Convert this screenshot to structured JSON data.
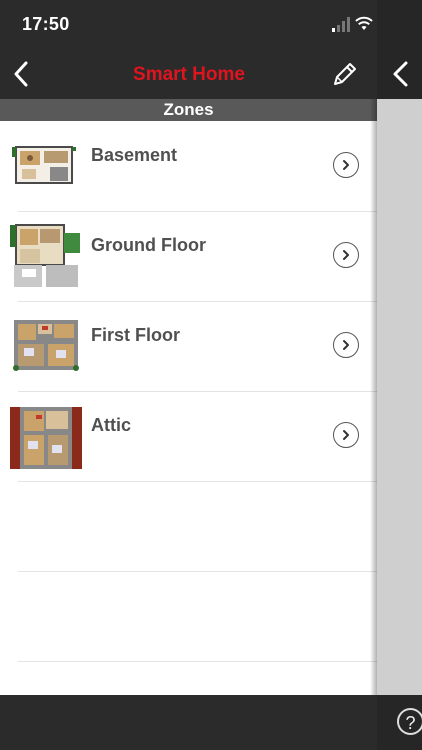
{
  "status": {
    "time": "17:50"
  },
  "nav": {
    "title": "Smart Home",
    "back_icon": "chevron-left-icon",
    "edit_icon": "pencil-icon"
  },
  "section": {
    "title": "Zones"
  },
  "zones": [
    {
      "label": "Basement"
    },
    {
      "label": "Ground Floor"
    },
    {
      "label": "First Floor"
    },
    {
      "label": "Attic"
    }
  ],
  "side": {
    "help_label": "?"
  },
  "colors": {
    "accent": "#e0141e",
    "bar": "#2b2b2b",
    "section": "#595959",
    "side_panel": "#cfcfcf"
  }
}
